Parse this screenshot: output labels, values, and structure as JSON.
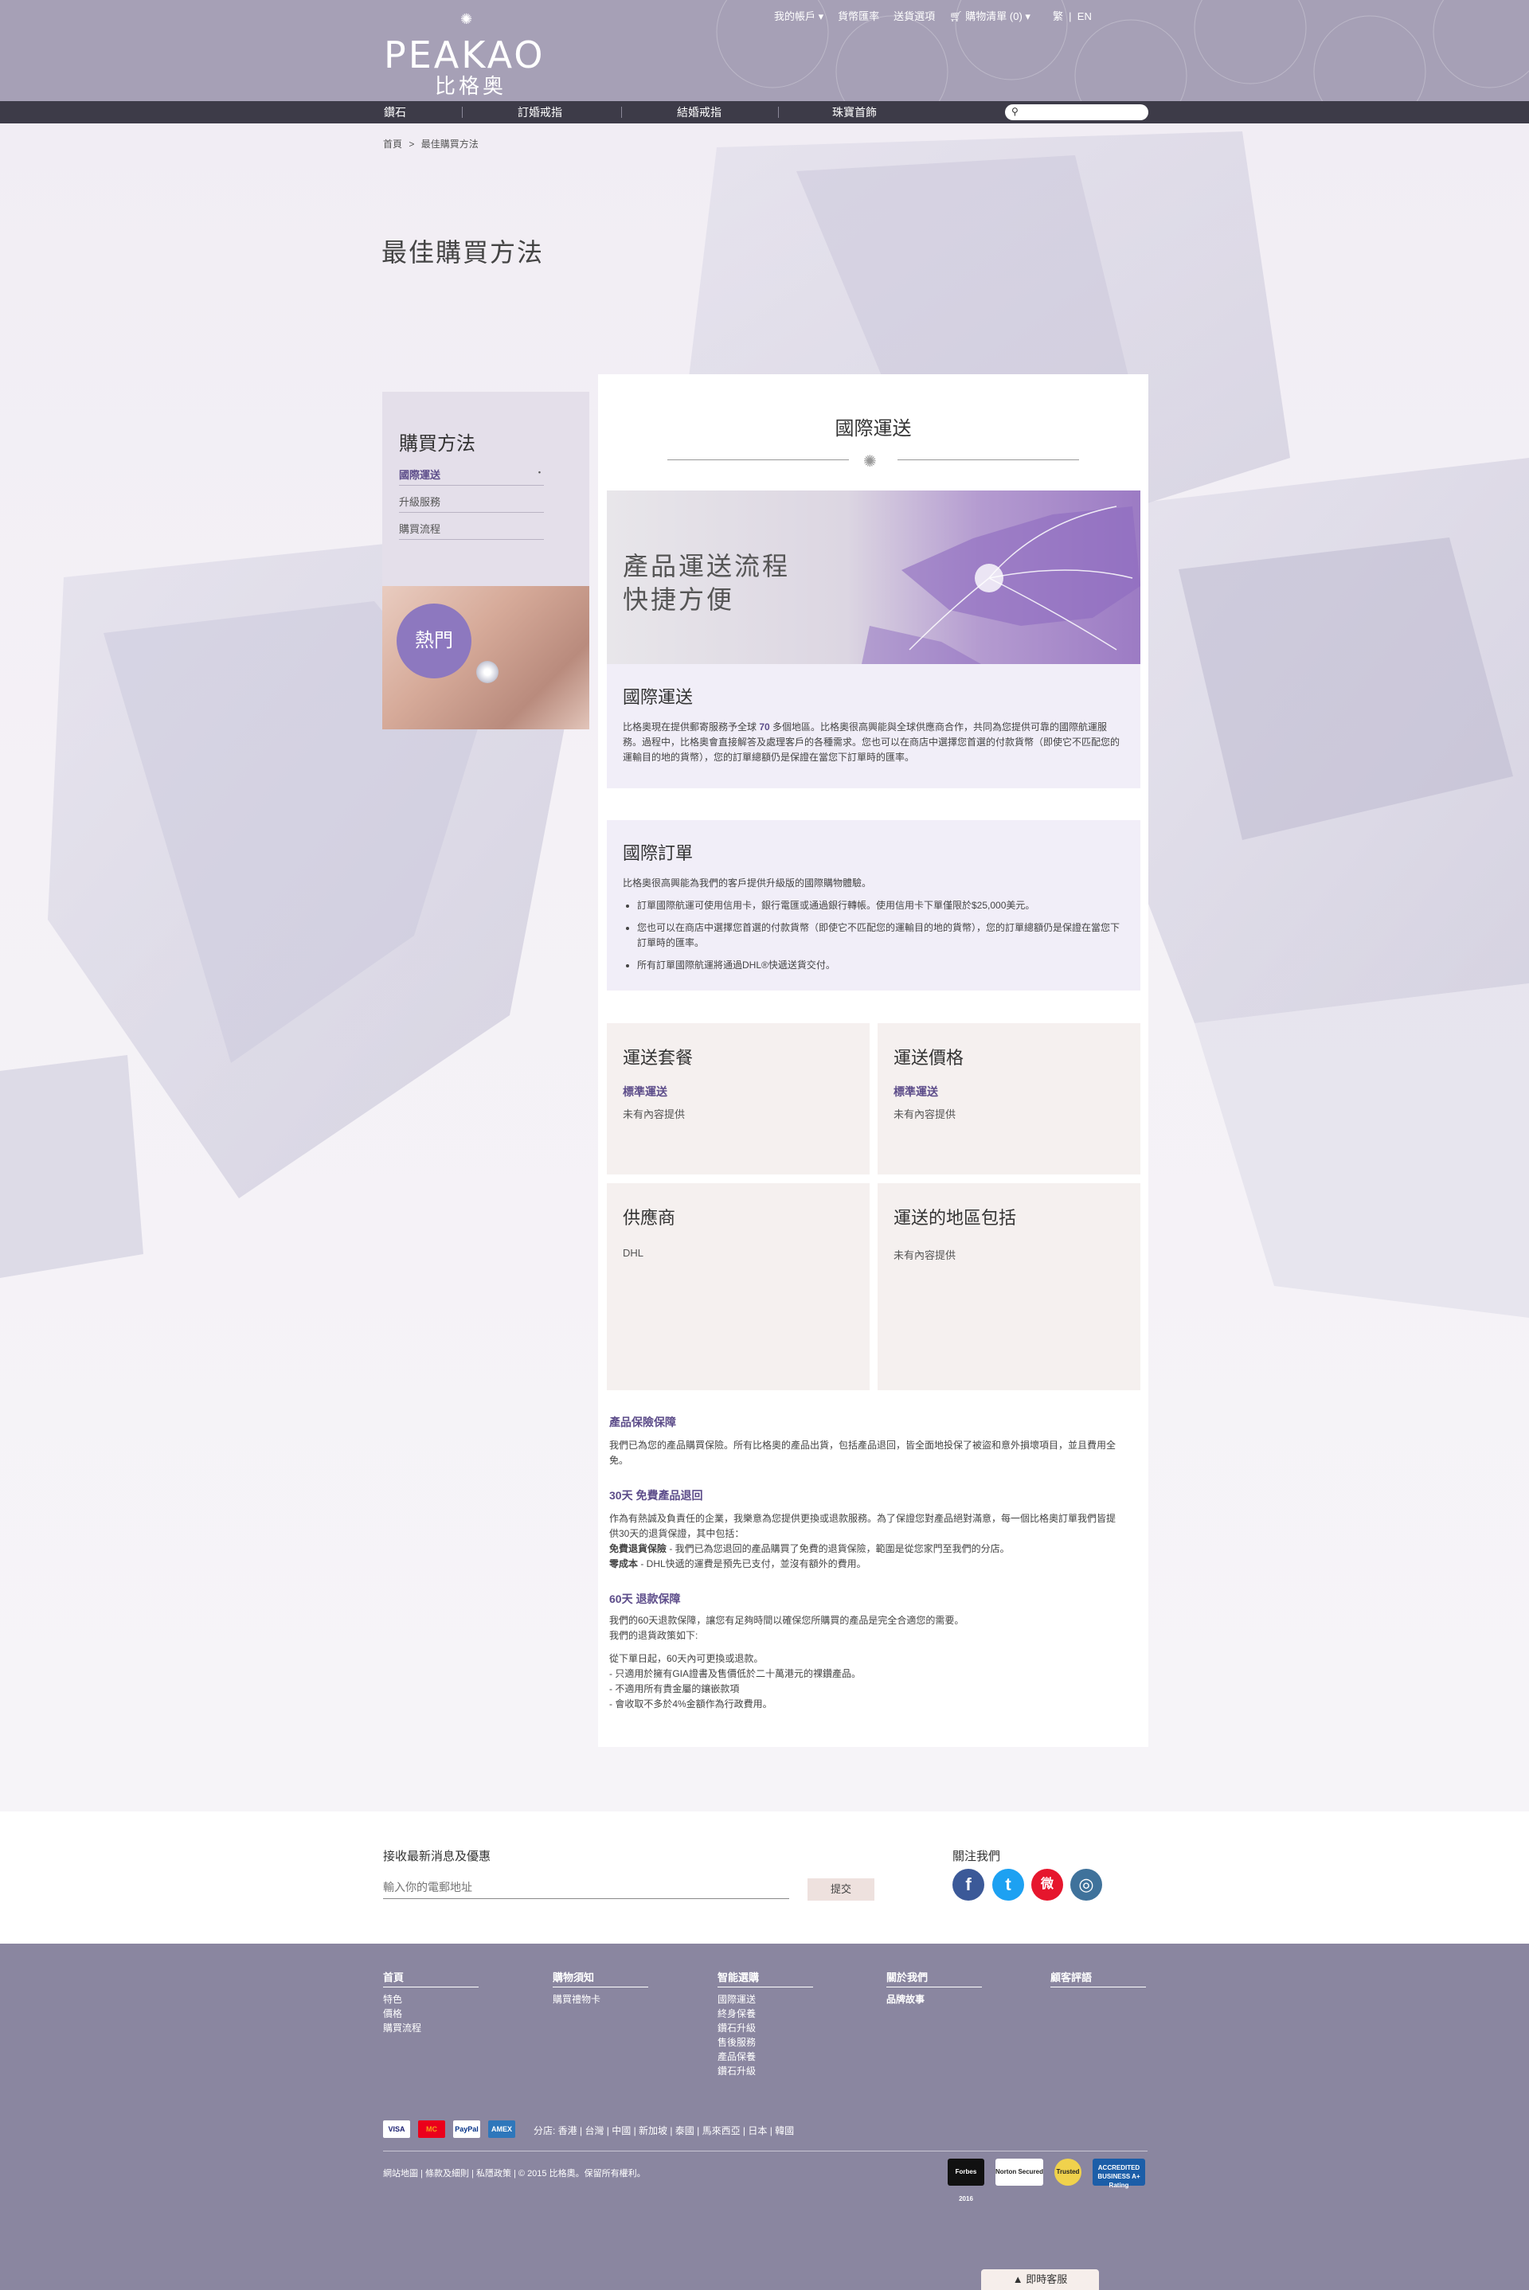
{
  "brand": {
    "logo_en": "PEAKAO",
    "logo_zh": "比格奥",
    "accent": "#5d4d8a",
    "header_bg": "#a6a0b6",
    "nav_bg": "#3d3b48",
    "footer_bg": "#8a86a0"
  },
  "topbar": {
    "account": "我的帳戶 ▾",
    "exchange": "貨幣匯率",
    "ship_to": "送貨選項",
    "cart": "購物清單 (0) ▾",
    "lang_zh": "繁",
    "lang_en": "EN"
  },
  "nav": {
    "items": [
      "鑽石",
      "訂婚戒指",
      "結婚戒指",
      "珠寶首飾"
    ],
    "search_icon": "search-icon"
  },
  "breadcrumb": {
    "home": "首頁",
    "sep": ">",
    "current": "最佳購買方法"
  },
  "page_title": "最佳購買方法",
  "sidebar": {
    "title": "購買方法",
    "items": [
      {
        "label": "國際運送",
        "active": true
      },
      {
        "label": "升級服務",
        "active": false
      },
      {
        "label": "購買流程",
        "active": false
      }
    ],
    "bullet": "•",
    "hot_badge": "熱門"
  },
  "main": {
    "heading": "國際運送",
    "banner": {
      "line1": "產品運送流程",
      "line2": "快捷方便"
    },
    "intl_shipping": {
      "title": "國際運送",
      "body_pre": "比格奧現在提供郵寄服務予全球 ",
      "body_num": "70",
      "body_post": " 多個地區。比格奧很高興能與全球供應商合作，共同為您提供可靠的國際航運服務。過程中，比格奧會直接解答及處理客戶的各種需求。您也可以在商店中選擇您首選的付款貨幣（即使它不匹配您的運輸目的地的貨幣），您的訂單總額仍是保證在當您下訂單時的匯率。"
    },
    "intl_orders": {
      "title": "國際訂單",
      "intro": "比格奧很高興能為我們的客戶提供升級版的國際購物體驗。",
      "bullets": [
        "訂單國際航運可使用信用卡，銀行電匯或通過銀行轉帳。使用信用卡下單僅限於$25,000美元。",
        "您也可以在商店中選擇您首選的付款貨幣（即使它不匹配您的運輸目的地的貨幣），您的訂單總額仍是保證在當您下訂單時的匯率。",
        "所有訂單國際航運將通過DHL®快遞送貨交付。"
      ]
    },
    "package": {
      "title": "運送套餐",
      "sub": "標準運送",
      "text": "未有內容提供"
    },
    "price": {
      "title": "運送價格",
      "sub": "標準運送",
      "text": "未有內容提供"
    },
    "supplier": {
      "title": "供應商",
      "text": "DHL"
    },
    "regions": {
      "title": "運送的地區包括",
      "text": "未有內容提供"
    },
    "insurance": {
      "title": "產品保險保障",
      "body": "我們已為您的產品購買保險。所有比格奧的產品出貨，包括產品退回，皆全面地投保了被盜和意外損壞項目，並且費用全免。"
    },
    "return30": {
      "title": "30天 免費產品退回",
      "body": "作為有熱誠及負責任的企業，我樂意為您提供更換或退款服務。為了保證您對產品絕對滿意，每一個比格奧訂單我們皆提供30天的退貨保證，其中包括：",
      "line2_bold": "免費退貨保險",
      "line2": " - 我們已為您退回的產品購買了免費的退貨保險，範圍是從您家門至我們的分店。",
      "line3_bold": "零成本",
      "line3": " - DHL快遞的運費是預先已支付，並沒有額外的費用。"
    },
    "return60": {
      "title": "60天 退款保障",
      "body1": "我們的60天退款保障，讓您有足夠時間以確保您所購買的產品是完全合適您的需要。",
      "body2": "我們的退貨政策如下:",
      "items": [
        "從下單日起，60天內可更換或退款。",
        "-  只適用於擁有GIA證書及售價低於二十萬港元的祼鑽產品。",
        "-  不適用所有貴金屬的鑲嵌款項",
        "-  會收取不多於4%金額作為行政費用。"
      ]
    }
  },
  "newsletter": {
    "label": "接收最新消息及優惠",
    "placeholder": "輸入你的電郵地址",
    "submit": "提交",
    "follow": "關注我們",
    "social": [
      {
        "name": "facebook-icon",
        "glyph": "f",
        "color": "#3b5998"
      },
      {
        "name": "twitter-icon",
        "glyph": "t",
        "color": "#1da1f2"
      },
      {
        "name": "weibo-icon",
        "glyph": "微",
        "color": "#e6162d"
      },
      {
        "name": "instagram-icon",
        "glyph": "◎",
        "color": "#3f729b"
      }
    ]
  },
  "footer": {
    "cols": [
      {
        "head": "首頁",
        "items": [
          "特色",
          "價格",
          "購買流程"
        ]
      },
      {
        "head": "購物須知",
        "items": [
          "購買禮物卡"
        ]
      },
      {
        "head": "智能選購",
        "items": [
          "國際運送",
          "終身保養",
          "鑽石升級",
          "售後服務",
          "產品保養",
          "鑽石升級"
        ]
      },
      {
        "head": "關於我們",
        "items": [
          "品牌故事"
        ]
      },
      {
        "head": "顧客評語",
        "items": []
      }
    ],
    "payment": [
      "VISA",
      "MC",
      "PayPal",
      "AMEX"
    ],
    "branches": "分店: 香港 | 台灣 | 中國 | 新加坡 | 泰國 | 馬來西亞 | 日本 | 韓國",
    "copyright": "網站地圖 | 條款及細則  | 私隱政策 | © 2015 比格奧。保留所有權利。",
    "seals": [
      "Forbes 2016",
      "Norton Secured",
      "Trusted",
      "ACCREDITED BUSINESS A+ Rating"
    ]
  },
  "chat": "▲  即時客服"
}
